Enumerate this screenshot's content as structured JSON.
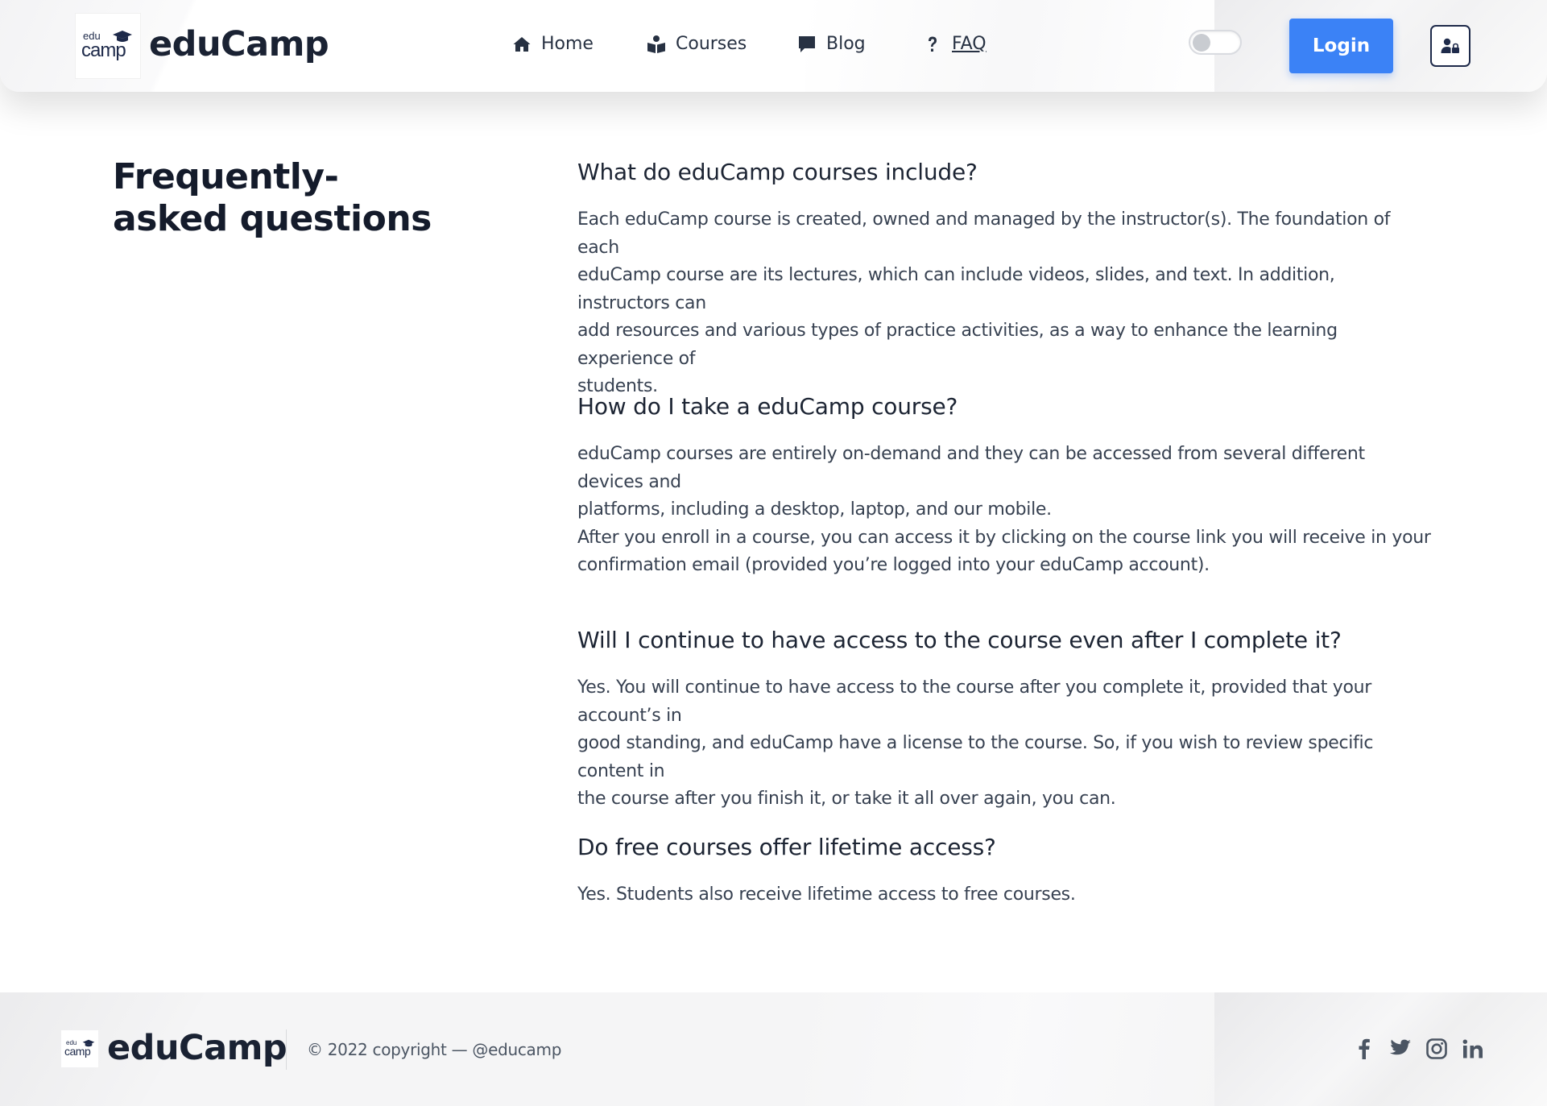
{
  "header": {
    "brand": "eduCamp",
    "logo": {
      "top_text": "edu",
      "bottom_text": "camp",
      "icon": "graduation-cap-icon"
    },
    "nav": [
      {
        "label": "Home",
        "icon": "home-icon"
      },
      {
        "label": "Courses",
        "icon": "book-reader-icon"
      },
      {
        "label": "Blog",
        "icon": "comment-icon"
      },
      {
        "label": "FAQ",
        "icon": "question-icon",
        "active": true
      }
    ],
    "theme_toggle": {
      "state": "off",
      "icon": "toggle-switch"
    },
    "login_label": "Login",
    "user_button_icon": "user-lock-icon",
    "accent_color": "#3b82f6"
  },
  "main": {
    "title": "Frequently-asked questions",
    "faqs": [
      {
        "question": "What do eduCamp courses include?",
        "answer_lines": [
          "Each eduCamp course is created, owned and managed by the instructor(s). The foundation of each",
          "eduCamp course are its lectures, which can include videos, slides, and text. In addition, instructors can",
          "add resources and various types of practice activities, as a way to enhance the learning experience of",
          "students."
        ]
      },
      {
        "question": "How do I take a eduCamp course?",
        "answer_lines": [
          "eduCamp courses are entirely on-demand and they can be accessed from several different devices and",
          "platforms, including a desktop, laptop, and our mobile.",
          "After you enroll in a course, you can access it by clicking on the course link you will receive in your",
          "confirmation email (provided you’re logged into your eduCamp account)."
        ]
      },
      {
        "question": "Will I continue to have access to the course even after I complete it?",
        "answer_lines": [
          "Yes. You will continue to have access to the course after you complete it, provided that your account’s in",
          "good standing, and eduCamp have a license to the course. So, if you wish to review specific content in",
          "the course after you finish it, or take it all over again, you can."
        ]
      },
      {
        "question": "Do free courses offer lifetime access?",
        "answer_lines": [
          "Yes. Students also receive lifetime access to free courses."
        ]
      }
    ]
  },
  "footer": {
    "brand": "eduCamp",
    "logo": {
      "top_text": "edu",
      "bottom_text": "camp"
    },
    "copyright": "© 2022 copyright — @educamp",
    "social": [
      {
        "name": "facebook-icon"
      },
      {
        "name": "twitter-icon"
      },
      {
        "name": "instagram-icon"
      },
      {
        "name": "linkedin-icon"
      }
    ]
  }
}
